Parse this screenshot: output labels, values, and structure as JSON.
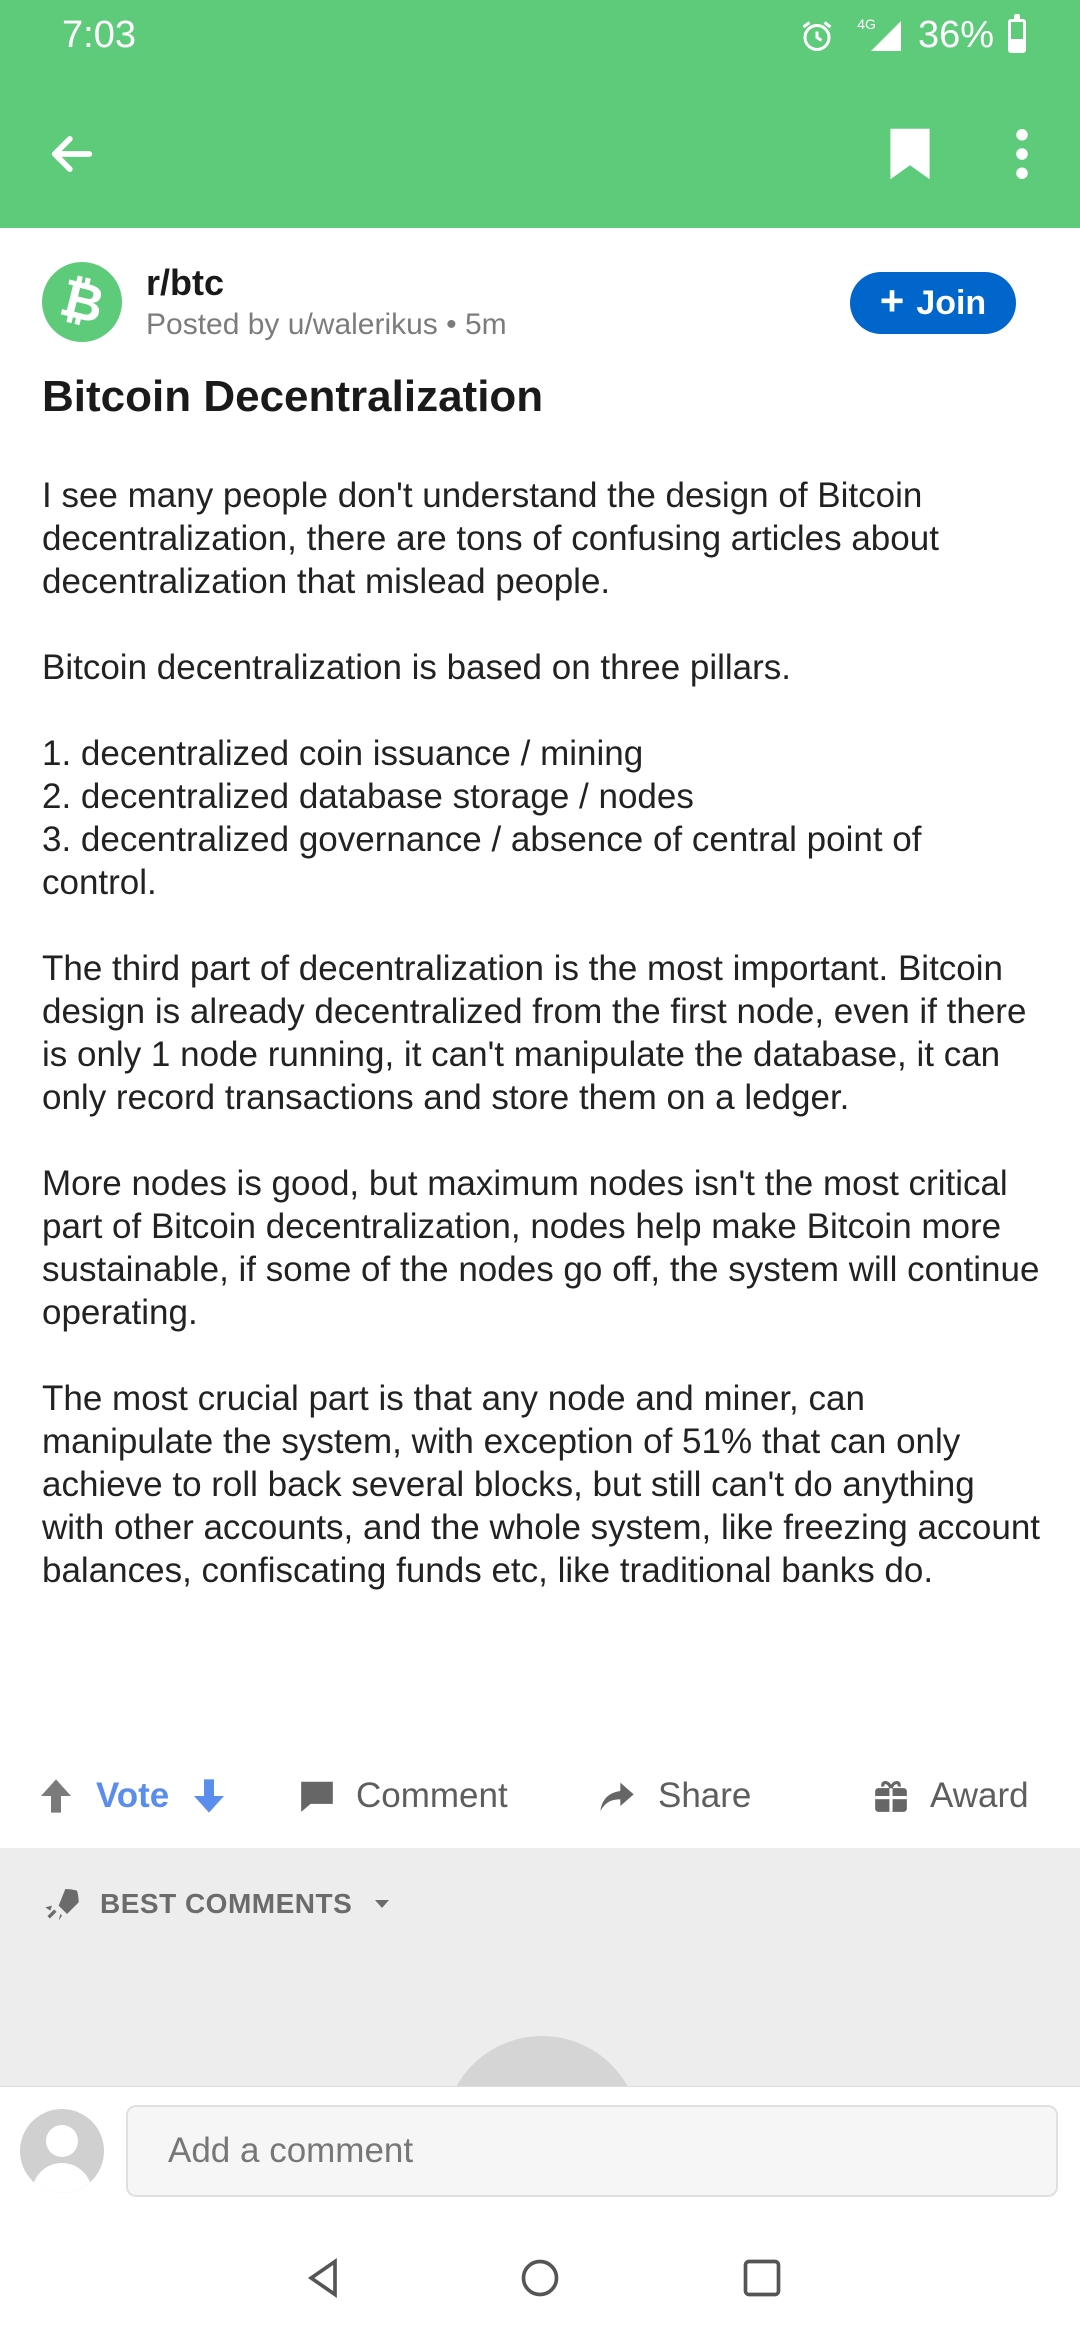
{
  "status_bar": {
    "time": "7:03",
    "network_label": "4G",
    "battery_percent": "36%",
    "battery_level": 0.36
  },
  "app_bar": {
    "back_icon": "arrow-left-icon",
    "bookmark_icon": "bookmark-icon",
    "more_icon": "more-vertical-icon"
  },
  "post": {
    "subreddit": "r/btc",
    "byline": "Posted by u/walerikus • 5m",
    "join_label": "Join",
    "title": "Bitcoin Decentralization",
    "paragraphs": [
      "I see many people don't understand the design of Bitcoin decentralization, there are tons of confusing articles about decentralization that mislead people.",
      "Bitcoin decentralization is based on three pillars.",
      "1. decentralized coin issuance / mining\n2. decentralized database storage / nodes\n3. decentralized governance / absence of central point of control.",
      "The third part of decentralization is the most important. Bitcoin design is already decentralized from the first node, even if there is only 1 node running, it can't manipulate the database, it can only record transactions and store them on a ledger.",
      "More nodes is good, but maximum nodes isn't the most critical part of Bitcoin decentralization, nodes help make Bitcoin more sustainable, if some of the nodes go off, the system will continue operating.",
      "The most crucial part is that any node and miner, can manipulate the system, with exception of 51% that can only achieve to roll back several blocks, but still can't do anything with other accounts, and the whole system, like freezing account balances, confiscating funds etc, like traditional banks do."
    ]
  },
  "actions": {
    "vote_label": "Vote",
    "comment_label": "Comment",
    "share_label": "Share",
    "award_label": "Award"
  },
  "comments": {
    "sort_label": "BEST COMMENTS"
  },
  "composer": {
    "placeholder": "Add a comment"
  },
  "colors": {
    "accent_green": "#5ecb7a",
    "join_blue": "#0066cc",
    "vote_blue": "#5b8def"
  }
}
